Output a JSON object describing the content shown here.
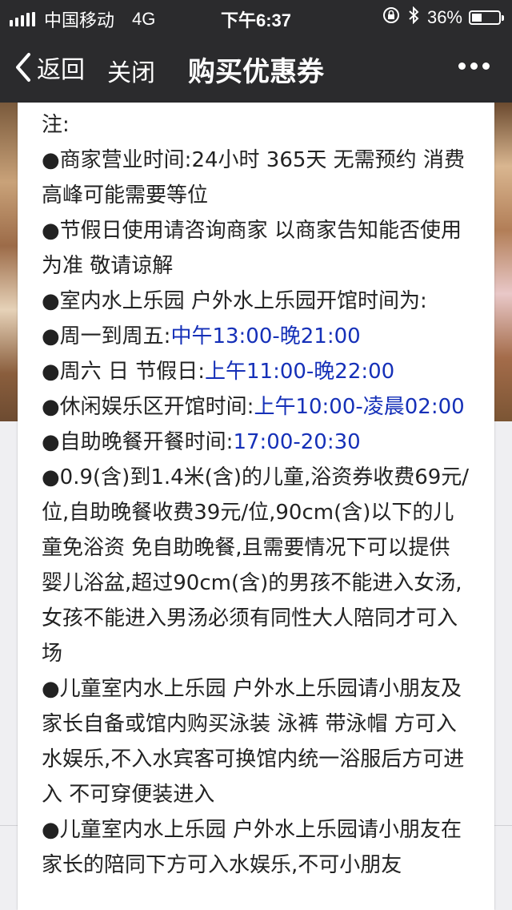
{
  "status_bar": {
    "carrier": "中国移动",
    "network": "4G",
    "time": "下午6:37",
    "battery_text": "36%",
    "battery_level": 0.36
  },
  "nav": {
    "back_label": "返回",
    "close_label": "关闭",
    "title": "购买优惠券"
  },
  "notes": {
    "heading": "注:",
    "items": [
      {
        "text": "●商家营业时间:24小时 365天 无需预约 消费高峰可能需要等位",
        "highlight": ""
      },
      {
        "text": "●节假日使用请咨询商家 以商家告知能否使用为准 敬请谅解",
        "highlight": ""
      },
      {
        "text": "●室内水上乐园 户外水上乐园开馆时间为:",
        "highlight": ""
      },
      {
        "text": "●周一到周五:",
        "highlight": "中午13:00-晚21:00"
      },
      {
        "text": "●周六 日 节假日:",
        "highlight": "上午11:00-晚22:00"
      },
      {
        "text": "●休闲娱乐区开馆时间:",
        "highlight": "上午10:00-凌晨02:00"
      },
      {
        "text": "●自助晚餐开餐时间:",
        "highlight": "17:00-20:30"
      },
      {
        "text": "●0.9(含)到1.4米(含)的儿童,浴资券收费69元/位,自助晚餐收费39元/位,90cm(含)以下的儿童免浴资 免自助晚餐,且需要情况下可以提供婴儿浴盆,超过90cm(含)的男孩不能进入女汤,女孩不能进入男汤必须有同性大人陪同才可入场",
        "highlight": ""
      },
      {
        "text": "●儿童室内水上乐园 户外水上乐园请小朋友及家长自备或馆内购买泳装 泳裤 带泳帽 方可入水娱乐,不入水宾客可换馆内统一浴服后方可进入 不可穿便装进入",
        "highlight": ""
      },
      {
        "text": "●儿童室内水上乐园 户外水上乐园请小朋友在家长的陪同下方可入水娱乐,不可小朋友",
        "highlight": ""
      }
    ]
  },
  "colors": {
    "bar_bg": "#2b2b2d",
    "highlight": "#1530b8",
    "text": "#222222"
  },
  "icons": [
    "signal-icon",
    "lock-rotation-icon",
    "bluetooth-icon",
    "battery-icon",
    "back-chevron-icon",
    "more-icon"
  ]
}
